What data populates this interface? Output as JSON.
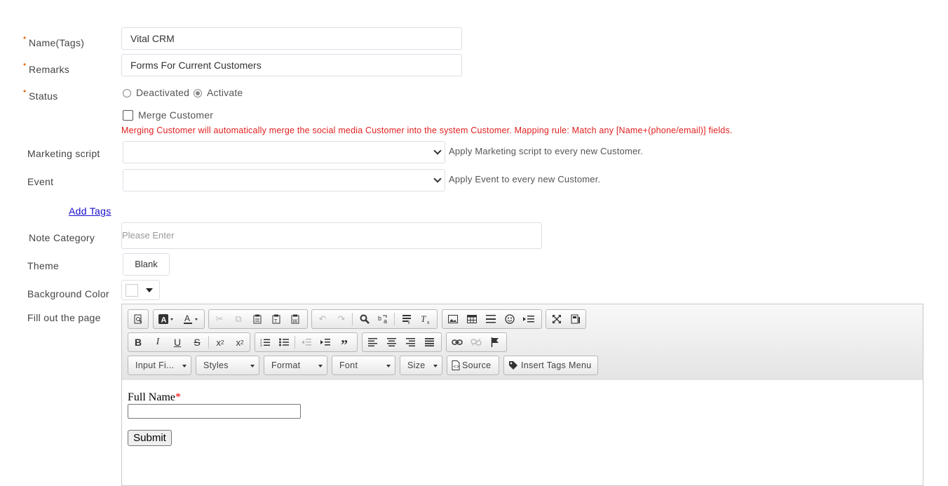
{
  "form": {
    "name_label": "Name(Tags)",
    "name_value": "Vital CRM",
    "remarks_label": "Remarks",
    "remarks_value": "Forms For Current Customers",
    "status_label": "Status",
    "status_options": [
      "Deactivated",
      "Activate"
    ],
    "status_selected": "Activate",
    "merge_label": "Merge Customer",
    "merge_checked": false,
    "merge_warning": "Merging Customer will automatically merge the social media Customer into the system Customer. Mapping rule: Match any [Name+(phone/email)] fields.",
    "marketing_label": "Marketing script",
    "marketing_value": "",
    "marketing_hint": "Apply Marketing script to every new Customer.",
    "event_label": "Event",
    "event_value": "",
    "event_hint": "Apply Event to every new Customer.",
    "add_tags_link": "Add Tags",
    "note_label": "Note Category",
    "note_placeholder": "Please Enter",
    "theme_label": "Theme",
    "theme_value": "Blank",
    "bg_label": "Background Color",
    "bg_color": "#ffffff",
    "fill_label": "Fill out the page"
  },
  "editor": {
    "toolbar_combos": {
      "input_fields": "Input Fi...",
      "styles": "Styles",
      "format": "Format",
      "font": "Font",
      "size": "Size"
    },
    "source_label": "Source",
    "insert_tags_label": "Insert Tags Menu",
    "content": {
      "field_label": "Full Name",
      "required_mark": "*",
      "submit_label": "Submit"
    }
  },
  "colors": {
    "required": "#e07020",
    "warning": "#e02020",
    "link": "#1a0dcc"
  }
}
